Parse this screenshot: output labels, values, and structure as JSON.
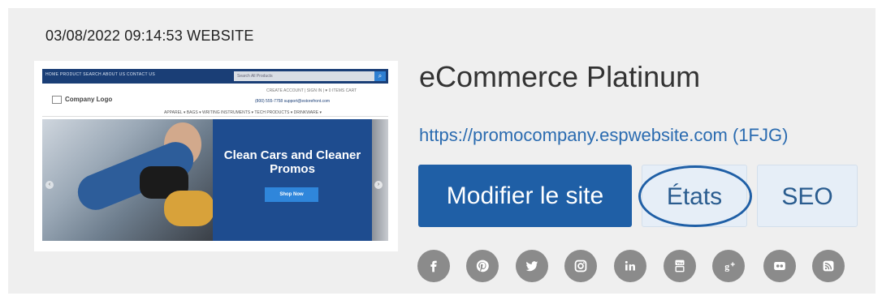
{
  "meta": "03/08/2022 09:14:53 WEBSITE",
  "thumbnail": {
    "nav_links": "HOME   PRODUCT SEARCH   ABOUT US   CONTACT US",
    "search_placeholder": "Search All Products",
    "search_icon": "search-icon",
    "util_links": "CREATE ACCOUNT  |  SIGN IN  |  ♥ 0 ITEMS  CART",
    "logo_text": "Company Logo",
    "contact": "(800) 555-7758   support@estorefront.com",
    "menu": "APPAREL ▾   BAGS ▾   WRITING INSTRUMENTS ▾   TECH PRODUCTS ▾   DRINKWARE ▾",
    "hero_title": "Clean Cars and Cleaner Promos",
    "hero_button": "Shop Now",
    "arrow_left": "‹",
    "arrow_right": "›"
  },
  "title": "eCommerce Platinum",
  "url": "https://promocompany.espwebsite.com (1FJG)",
  "buttons": {
    "edit": "Modifier le site",
    "states": "États",
    "seo": "SEO"
  },
  "social": [
    "facebook-icon",
    "pinterest-icon",
    "twitter-icon",
    "instagram-icon",
    "linkedin-icon",
    "youtube-icon",
    "google-plus-icon",
    "flickr-icon",
    "rss-icon"
  ],
  "colors": {
    "primary": "#1f5fa6",
    "link": "#2a6bb0",
    "social_gray": "#8b8b8b",
    "card_bg": "#efefef"
  }
}
